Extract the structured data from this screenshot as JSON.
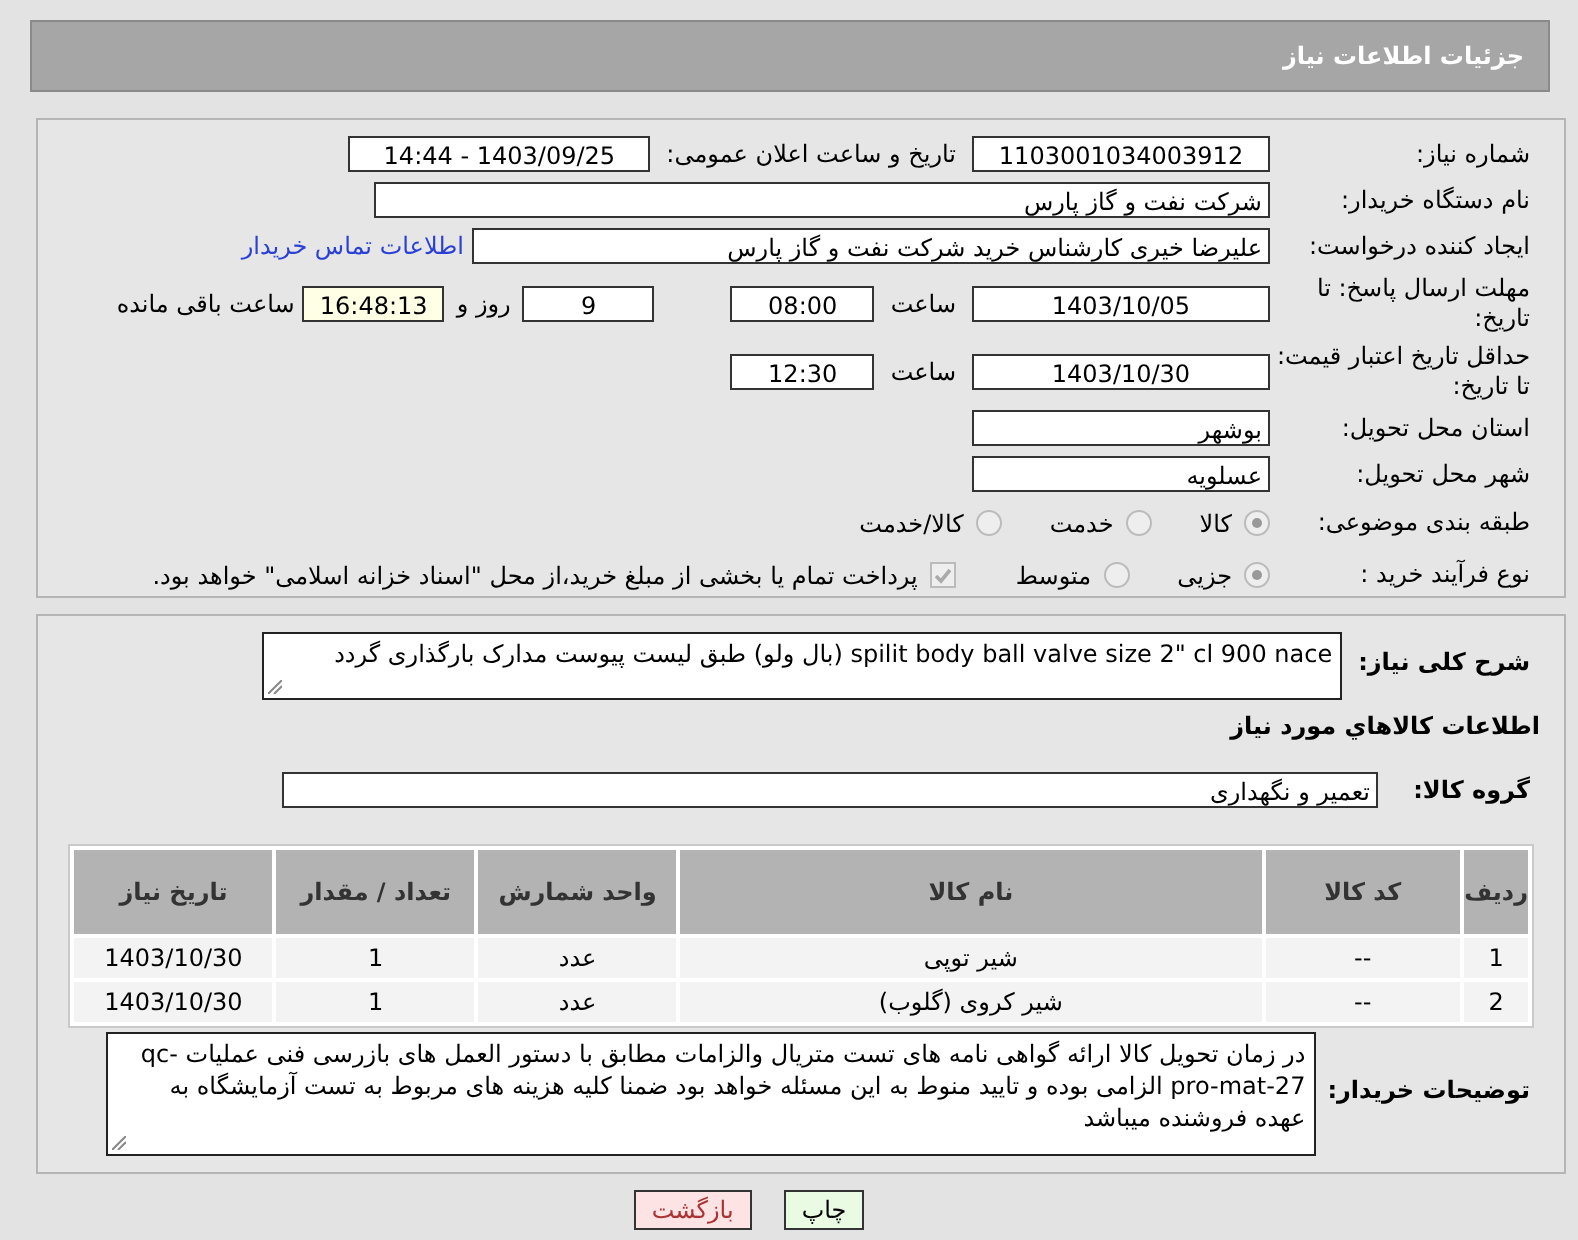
{
  "header": {
    "title": "جزئیات اطلاعات نیاز"
  },
  "details": {
    "need_number": {
      "label": "شماره نیاز:",
      "value": "1103001034003912"
    },
    "announce": {
      "label": "تاریخ و ساعت اعلان عمومی:",
      "value": "1403/09/25 - 14:44"
    },
    "buyer": {
      "label": "نام دستگاه خریدار:",
      "value": "شرکت نفت و گاز پارس"
    },
    "requester": {
      "label": "ایجاد کننده درخواست:",
      "value": "علیرضا  خیری کارشناس خرید  شرکت نفت و گاز پارس",
      "link": "اطلاعات تماس خریدار"
    },
    "deadline": {
      "label": "مهلت ارسال پاسخ: تا تاریخ:",
      "date": "1403/10/05",
      "time_label": "ساعت",
      "time": "08:00",
      "days": "9",
      "days_label": "روز و",
      "remaining": "16:48:13",
      "remaining_label": "ساعت باقی مانده"
    },
    "validity": {
      "label": "حداقل تاریخ اعتبار قیمت: تا تاریخ:",
      "date": "1403/10/30",
      "time_label": "ساعت",
      "time": "12:30"
    },
    "province": {
      "label": "استان محل تحویل:",
      "value": "بوشهر"
    },
    "city": {
      "label": "شهر محل تحویل:",
      "value": "عسلویه"
    },
    "category": {
      "label": "طبقه بندی موضوعی:",
      "options": [
        {
          "label": "کالا",
          "selected": true
        },
        {
          "label": "خدمت",
          "selected": false
        },
        {
          "label": "کالا/خدمت",
          "selected": false
        }
      ]
    },
    "process": {
      "label": "نوع فرآیند خرید :",
      "options": [
        {
          "label": "جزیی",
          "selected": true
        },
        {
          "label": "متوسط",
          "selected": false
        }
      ],
      "payment": {
        "checked": true,
        "text": "پرداخت تمام یا بخشی از مبلغ خرید،از محل \"اسناد خزانه اسلامی\" خواهد بود."
      }
    }
  },
  "goods": {
    "description": {
      "label": "شرح کلی نیاز:",
      "value": "spilit body ball valve size 2\" cl 900 nace (بال ولو) طبق لیست پیوست مدارک بارگذاری گردد"
    },
    "section_title": "اطلاعات کالاهاي مورد نیاز",
    "group": {
      "label": "گروه کالا:",
      "value": "تعمیر و نگهداری"
    },
    "table": {
      "columns": [
        "ردیف",
        "کد کالا",
        "نام کالا",
        "واحد شمارش",
        "تعداد / مقدار",
        "تاریخ نیاز"
      ],
      "rows": [
        [
          "1",
          "--",
          "شیر توپی",
          "عدد",
          "1",
          "1403/10/30"
        ],
        [
          "2",
          "--",
          "شیر کروی (گلوب)",
          "عدد",
          "1",
          "1403/10/30"
        ]
      ]
    },
    "notes": {
      "label": "توضیحات خریدار:",
      "value": "در زمان تحویل کالا ارائه گواهی نامه های تست متریال والزامات مطابق با دستور العمل های بازرسی فنی عملیات qc-pro-mat-27  الزامی بوده و تایید منوط به این مسئله خواهد بود ضمنا کلیه هزینه های مربوط به تست آزمایشگاه به عهده فروشنده میباشد"
    }
  },
  "buttons": [
    {
      "kind": "print",
      "label": "چاپ"
    },
    {
      "kind": "back",
      "label": "بازگشت"
    }
  ]
}
